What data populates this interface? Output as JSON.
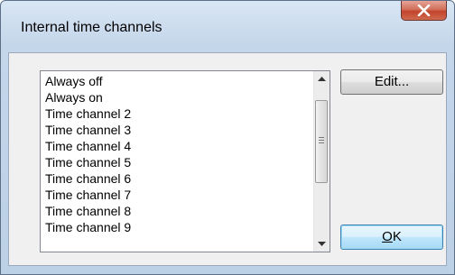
{
  "window": {
    "title": "Internal time channels"
  },
  "listbox": {
    "items": [
      "Always off",
      "Always on",
      "Time channel 2",
      "Time channel 3",
      "Time channel 4",
      "Time channel 5",
      "Time channel 6",
      "Time channel 7",
      "Time channel 8",
      "Time channel 9"
    ]
  },
  "buttons": {
    "edit_label": "Edit...",
    "ok_mnemonic": "O",
    "ok_rest": "K"
  },
  "icons": {
    "close": "close-icon",
    "scroll_up": "arrow-up-icon",
    "scroll_down": "arrow-down-icon",
    "scroll_grip": "grip-icon"
  },
  "colors": {
    "close_button": "#c2432b",
    "ok_button_border": "#3c7fb1"
  }
}
